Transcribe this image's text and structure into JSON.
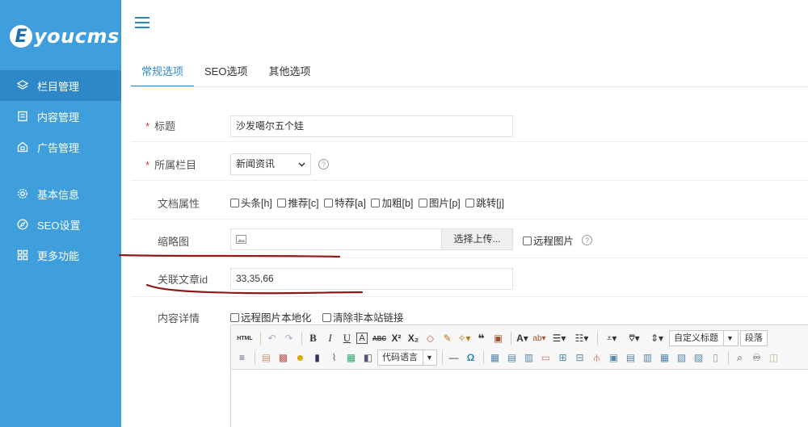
{
  "brand": {
    "logo_letter": "E",
    "logo_text": "youcms"
  },
  "sidebar": {
    "items": [
      {
        "label": "栏目管理",
        "icon": "layers-icon",
        "active": true
      },
      {
        "label": "内容管理",
        "icon": "document-icon",
        "active": false
      },
      {
        "label": "广告管理",
        "icon": "ad-icon",
        "active": false
      },
      {
        "label": "基本信息",
        "icon": "gear-icon",
        "active": false
      },
      {
        "label": "SEO设置",
        "icon": "compass-icon",
        "active": false
      },
      {
        "label": "更多功能",
        "icon": "grid-icon",
        "active": false
      }
    ]
  },
  "tabs": [
    {
      "label": "常规选项",
      "active": true
    },
    {
      "label": "SEO选项",
      "active": false
    },
    {
      "label": "其他选项",
      "active": false
    }
  ],
  "form": {
    "title": {
      "required_mark": "*",
      "label": "标题",
      "value": "沙发噶尔五个娃"
    },
    "category": {
      "required_mark": "*",
      "label": "所属栏目",
      "value": "新闻资讯",
      "help": "?"
    },
    "attributes": {
      "label": "文档属性",
      "options": [
        "头条[h]",
        "推荐[c]",
        "特荐[a]",
        "加粗[b]",
        "图片[p]",
        "跳转[j]"
      ]
    },
    "thumbnail": {
      "label": "缩略图",
      "upload_label": "选择上传...",
      "remote_label": "远程图片",
      "help": "?"
    },
    "related": {
      "label": "关联文章id",
      "value": "33,35,66"
    },
    "content": {
      "label": "内容详情",
      "localize_label": "远程图片本地化",
      "remove_links_label": "清除非本站链接"
    }
  },
  "editor": {
    "html_label": "HTML",
    "custom_heading": "自定义标题",
    "paragraph": "段落",
    "code_language": "代码语言",
    "omega": "Ω"
  },
  "colors": {
    "sidebar": "#3f9fdd",
    "sidebar_active": "#2e88c7",
    "accent": "#2e88c7",
    "required": "#e4393c",
    "annotation": "#8b1a1a"
  }
}
